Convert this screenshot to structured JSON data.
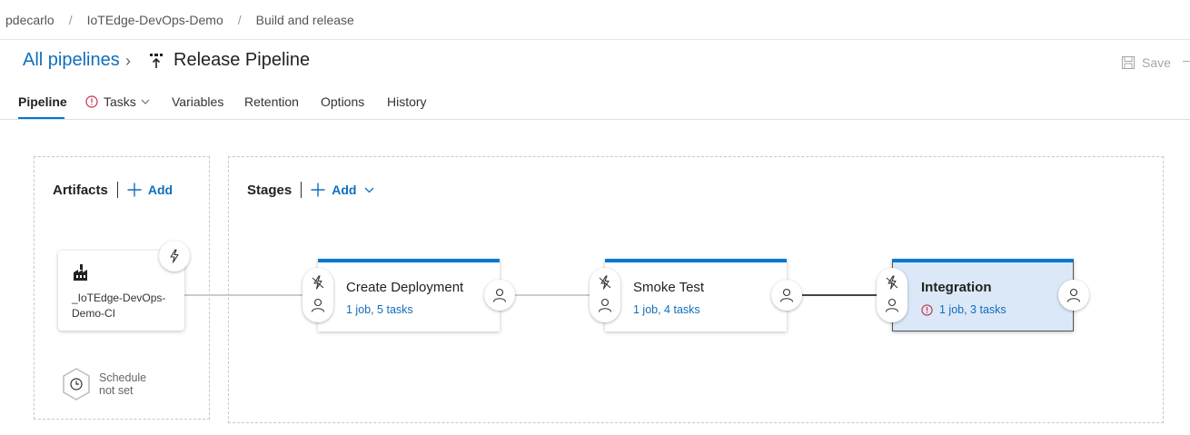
{
  "breadcrumb": [
    "pdecarlo",
    "IoTEdge-DevOps-Demo",
    "Build and release"
  ],
  "header": {
    "all_pipelines": "All pipelines",
    "title": "Release Pipeline",
    "save_label": "Save",
    "more": "–"
  },
  "tabs": [
    {
      "label": "Pipeline",
      "active": true
    },
    {
      "label": "Tasks",
      "warning": true,
      "dropdown": true
    },
    {
      "label": "Variables"
    },
    {
      "label": "Retention"
    },
    {
      "label": "Options"
    },
    {
      "label": "History"
    }
  ],
  "artifacts": {
    "heading": "Artifacts",
    "add_label": "Add",
    "card_name": "_IoTEdge-DevOps-Demo-CI",
    "schedule_line1": "Schedule",
    "schedule_line2": "not set"
  },
  "stages": {
    "heading": "Stages",
    "add_label": "Add",
    "items": [
      {
        "name": "Create Deployment",
        "summary": "1 job, 5 tasks",
        "selected": false,
        "warning": false
      },
      {
        "name": "Smoke Test",
        "summary": "1 job, 4 tasks",
        "selected": false,
        "warning": false
      },
      {
        "name": "Integration",
        "summary": "1 job, 3 tasks",
        "selected": true,
        "warning": true
      }
    ]
  },
  "colors": {
    "accent": "#0078d4",
    "link": "#106ebe",
    "warning": "#c4314b",
    "selected_bg": "#dbe8f7"
  }
}
